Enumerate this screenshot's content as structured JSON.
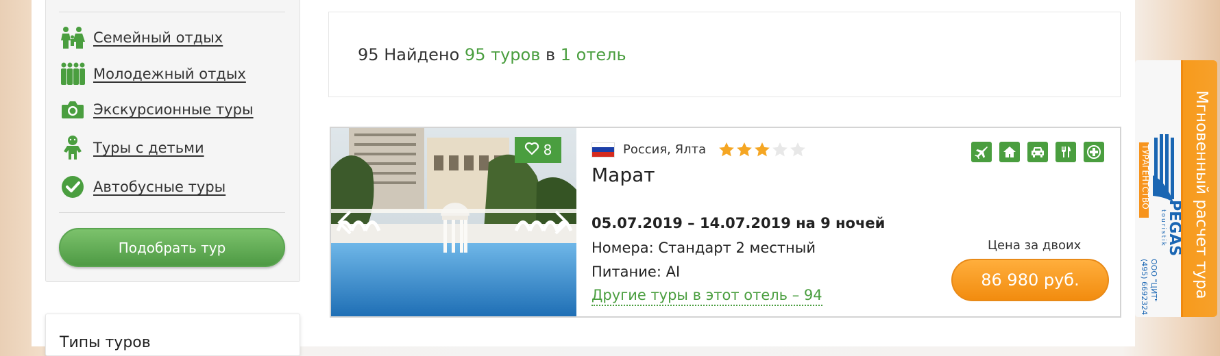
{
  "sidebar": {
    "items": [
      {
        "label": "Семейный отдых",
        "icon": "family-icon"
      },
      {
        "label": "Молодежный отдых",
        "icon": "youth-group-icon"
      },
      {
        "label": "Экскурсионные туры",
        "icon": "camera-icon"
      },
      {
        "label": "Туры с детьми",
        "icon": "child-icon"
      },
      {
        "label": "Автобусные туры",
        "icon": "checkmark-icon"
      }
    ],
    "pick_button": "Подобрать тур"
  },
  "tour_types": {
    "title": "Типы туров"
  },
  "summary": {
    "count_prefix": "95",
    "found_label": "Найдено",
    "tours_count": "95 туров",
    "in_label": "в",
    "hotels_count": "1 отель"
  },
  "hotel_card": {
    "favorites_count": "8",
    "location": "Россия, Ялта",
    "stars_total": 5,
    "stars_filled": 3,
    "name": "Марат",
    "dates": "05.07.2019 – 14.07.2019 на 9 ночей",
    "room": "Номера: Стандарт 2 местный",
    "meal": "Питание: AI",
    "other_tours": "Другие туры в этот отель – 94",
    "services": [
      "airplane-icon",
      "house-icon",
      "car-icon",
      "utensils-icon",
      "plus-icon"
    ],
    "price_label": "Цена за двоих",
    "price": "86 980 руб."
  },
  "widget": {
    "calc_tab": "Мгновенный расчет тура",
    "agency_label": "ТУРАГЕНТСТВО",
    "brand": "PEGAS",
    "brand_sub": "touristik",
    "company": "ООО \"ЦИТ\"",
    "phone": "(495) 6692324"
  },
  "colors": {
    "accent_green": "#4a9e3f",
    "accent_orange": "#f7941d",
    "star_gold": "#f5a623"
  }
}
